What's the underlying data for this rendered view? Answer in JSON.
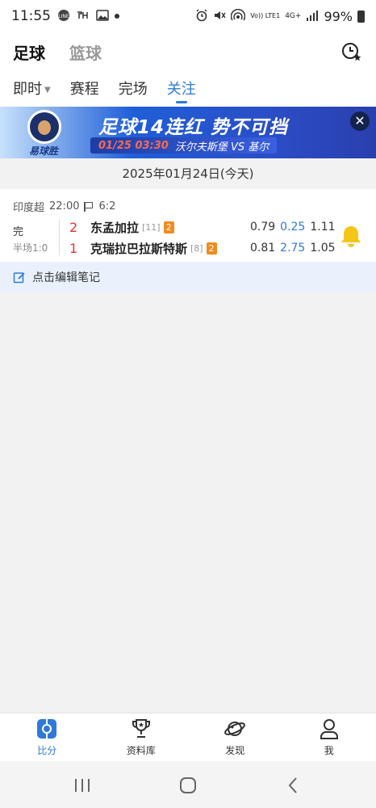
{
  "status_bar": {
    "time": "11:55",
    "icons": [
      "line-icon",
      "kakao-icon",
      "gallery-icon",
      "dot-icon",
      "alarm-icon",
      "mute-icon",
      "hotspot-icon",
      "volte-icon",
      "4g-icon",
      "signal-icon"
    ],
    "volte": "Vo)) LTE1",
    "network": "4G+",
    "battery": "99%"
  },
  "header": {
    "sports": [
      "足球",
      "篮球"
    ],
    "active_sport": "足球"
  },
  "tabs": [
    "即时",
    "赛程",
    "完场",
    "关注"
  ],
  "active_tab": "关注",
  "banner": {
    "headline": "足球14连红 势不可挡",
    "brand": "易球胜",
    "date": "01/25 03:30",
    "teams": "沃尔夫斯堡 VS 基尔"
  },
  "date_header": "2025年01月24日(今天)",
  "match": {
    "league": "印度超",
    "time": "22:00",
    "corners": "6:2",
    "status": "完",
    "halftime": "半场1:0",
    "home": {
      "score": "2",
      "name": "东孟加拉",
      "rank": "[11]",
      "cards": "2",
      "odds": [
        "0.79",
        "0.25",
        "1.11"
      ]
    },
    "away": {
      "score": "1",
      "name": "克瑞拉巴拉斯特斯",
      "rank": "[8]",
      "cards": "2",
      "odds": [
        "0.81",
        "2.75",
        "1.05"
      ]
    },
    "bell_color": "#f5c518"
  },
  "note": "点击编辑笔记",
  "bottom_nav": [
    {
      "label": "比分",
      "icon": "score-icon"
    },
    {
      "label": "资料库",
      "icon": "trophy-icon"
    },
    {
      "label": "发现",
      "icon": "planet-icon"
    },
    {
      "label": "我",
      "icon": "profile-icon"
    }
  ],
  "accent_color": "#2f7ad8"
}
